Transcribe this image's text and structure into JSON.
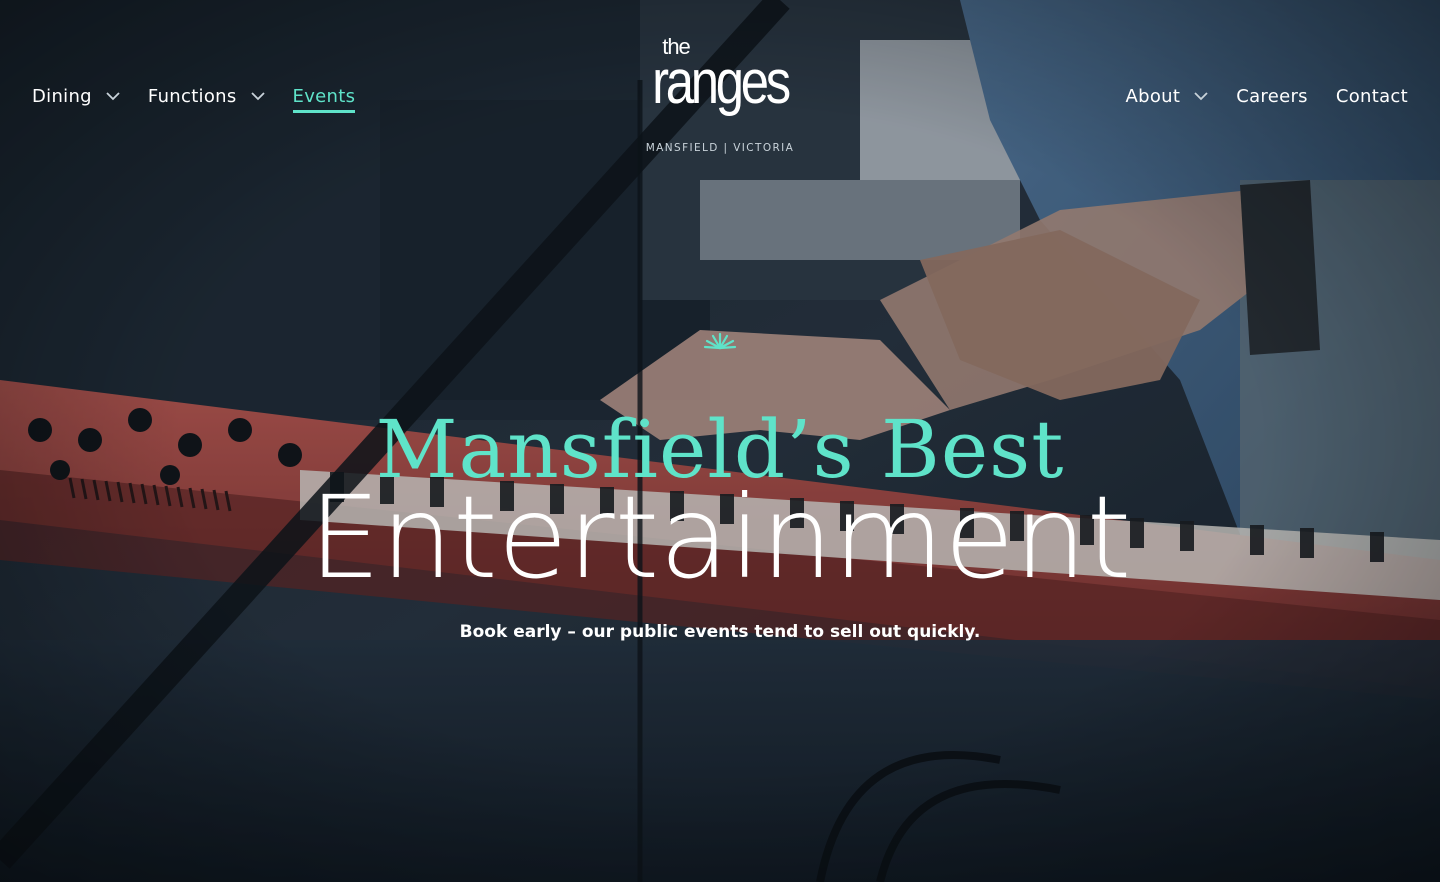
{
  "nav": {
    "left": [
      {
        "label": "Dining",
        "has_dropdown": true,
        "active": false
      },
      {
        "label": "Functions",
        "has_dropdown": true,
        "active": false
      },
      {
        "label": "Events",
        "has_dropdown": false,
        "active": true
      }
    ],
    "right": [
      {
        "label": "About",
        "has_dropdown": true
      },
      {
        "label": "Careers",
        "has_dropdown": false
      },
      {
        "label": "Contact",
        "has_dropdown": false
      }
    ]
  },
  "logo": {
    "the": "the",
    "name": "ranges",
    "tagline": "MANSFIELD | VICTORIA"
  },
  "hero": {
    "ornament_icon": "sparkle-icon",
    "headline_accent": "Mansfield’s Best",
    "headline_main": "Entertainment",
    "subtext": "Book early – our public events tend to sell out quickly.",
    "background": "musician-playing-red-keyboard-photo"
  },
  "colors": {
    "accent": "#5fe3c9",
    "text": "#ffffff",
    "tagline": "#c9d3da"
  }
}
